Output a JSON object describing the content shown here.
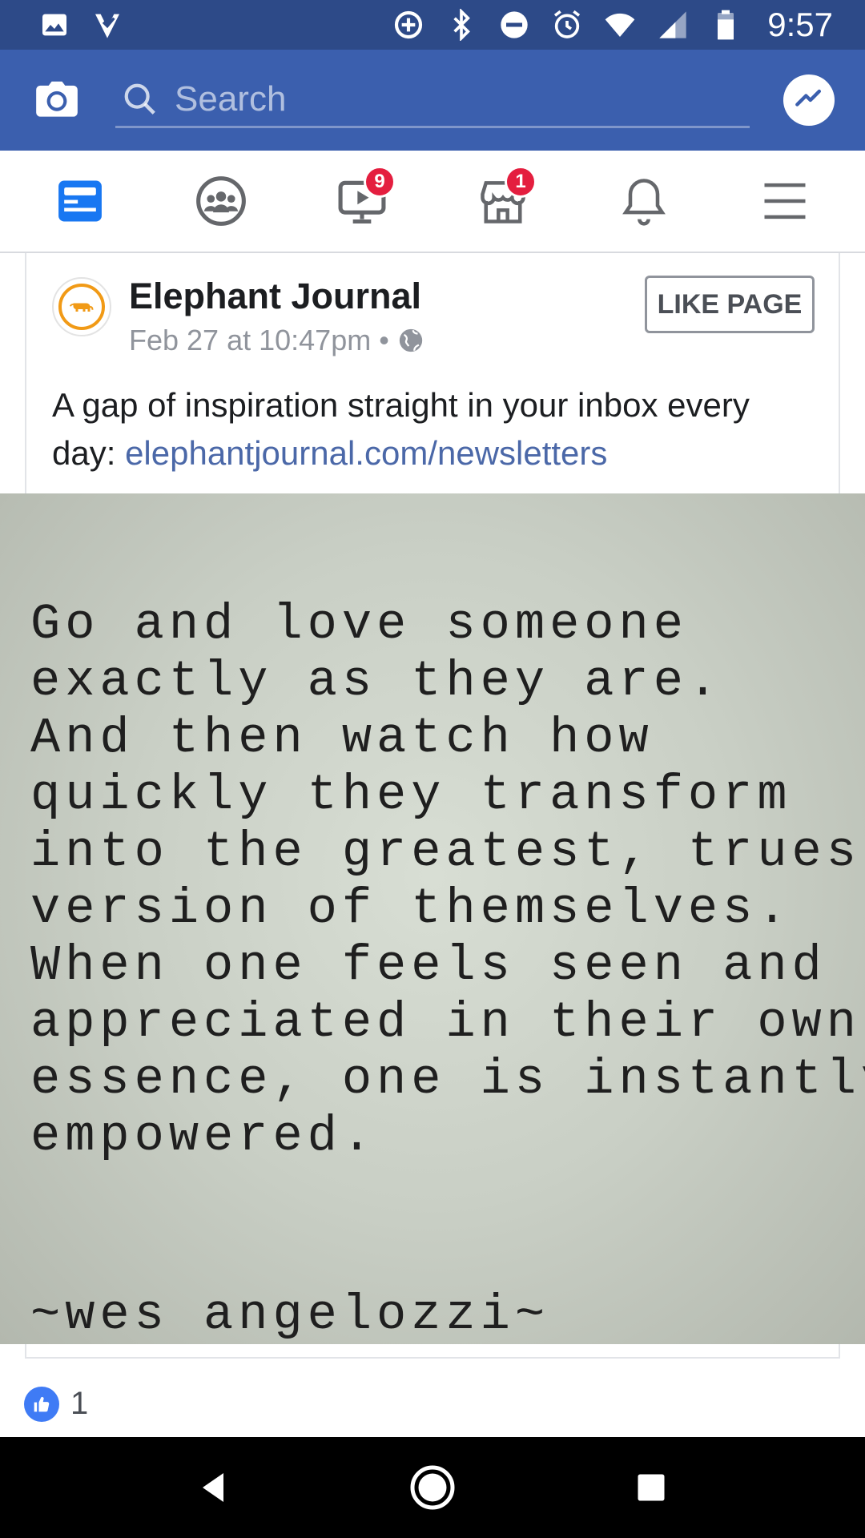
{
  "status_bar": {
    "time": "9:57",
    "icons": [
      "image-icon",
      "check-icon",
      "data-saver-icon",
      "bluetooth-icon",
      "do-not-disturb-icon",
      "alarm-icon",
      "wifi-icon",
      "signal-icon",
      "battery-icon"
    ]
  },
  "app_bar": {
    "search_placeholder": "Search",
    "icons": [
      "camera-icon",
      "search-icon",
      "messenger-icon"
    ],
    "brand_color": "#3b5fae"
  },
  "tabs": [
    {
      "name": "news-feed",
      "icon": "news-feed-icon",
      "active": true,
      "badge": ""
    },
    {
      "name": "groups",
      "icon": "groups-icon",
      "active": false,
      "badge": ""
    },
    {
      "name": "watch",
      "icon": "watch-icon",
      "active": false,
      "badge": "9"
    },
    {
      "name": "marketplace",
      "icon": "marketplace-icon",
      "active": false,
      "badge": "1"
    },
    {
      "name": "notifications",
      "icon": "bell-icon",
      "active": false,
      "badge": ""
    },
    {
      "name": "menu",
      "icon": "menu-icon",
      "active": false,
      "badge": ""
    }
  ],
  "post": {
    "page_name": "Elephant Journal",
    "timestamp": "Feb 27 at 10:47pm",
    "separator": "•",
    "like_page_label": "LIKE PAGE",
    "text_prefix": "A gap of inspiration straight in your inbox every day: ",
    "link": "elephantjournal.com/newsletters",
    "image_quote": "Go and love someone\nexactly as they are.\nAnd then watch how\nquickly they transform\ninto the greatest, truest\nversion of themselves.\nWhen one feels seen and\nappreciated in their own\nessence, one is instantly\nempowered.",
    "image_author": "~wes angelozzi~",
    "reaction_count": "1"
  },
  "nav_bar": {
    "buttons": [
      "back-icon",
      "home-icon",
      "recents-icon"
    ]
  }
}
